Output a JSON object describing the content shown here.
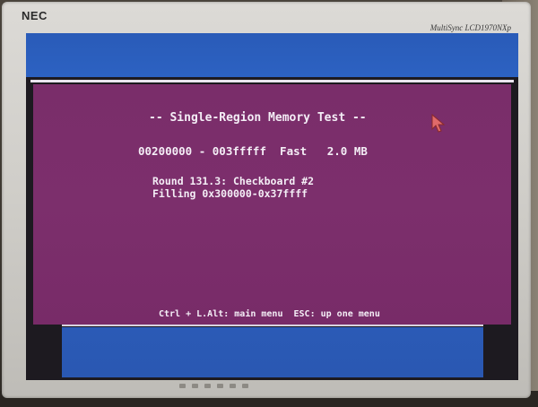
{
  "monitor": {
    "brand": "NEC",
    "model": "MultiSync LCD1970NXp"
  },
  "terminal": {
    "title": "-- Single-Region Memory Test --",
    "range_line": "00200000 - 003fffff  Fast   2.0 MB",
    "round_line": "Round 131.3: Checkboard #2",
    "filling_line": "Filling 0x300000-0x37ffff",
    "help_line": "Ctrl + L.Alt: main menu  ESC: up one menu"
  },
  "colors": {
    "panel_bg": "#7a2d6a",
    "band_bg": "#2a5bb8",
    "text": "#f4eef6",
    "cursor": "#e06a6a"
  },
  "icons": {
    "pointer": "arrow-cursor-icon"
  }
}
